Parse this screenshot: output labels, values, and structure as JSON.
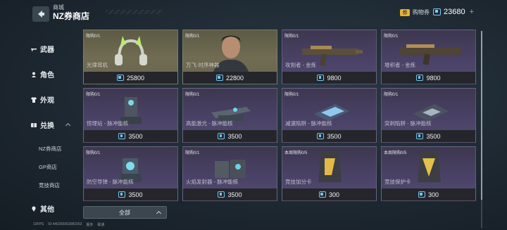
{
  "header": {
    "breadcrumb": "商城",
    "title": "NZ券商店",
    "voucher_icon_text": "券",
    "voucher_label": "购物券",
    "nz_balance": "23680",
    "plus": "+"
  },
  "sidebar": {
    "items": [
      {
        "label": "武器",
        "icon": "rifle-icon"
      },
      {
        "label": "角色",
        "icon": "person-icon"
      },
      {
        "label": "外观",
        "icon": "shirt-icon"
      },
      {
        "label": "兑换",
        "icon": "exchange-icon"
      },
      {
        "label": "其他",
        "icon": "pin-icon"
      }
    ],
    "sub_items": [
      "NZ券商店",
      "GP商店",
      "竞技商店"
    ]
  },
  "cards": [
    {
      "limit": "限购0/1",
      "name": "光律耳机",
      "price": "25800",
      "theme": "gold"
    },
    {
      "limit": "限购0/1",
      "name": "万飞·时序神器",
      "price": "22800",
      "theme": "gold"
    },
    {
      "limit": "限购0/1",
      "name": "攻割者 - 金炼",
      "price": "9800",
      "theme": "purple"
    },
    {
      "limit": "限购0/1",
      "name": "堆积者 - 金炼",
      "price": "9800",
      "theme": "purple"
    },
    {
      "limit": "限购0/1",
      "name": "惊理站 - 脉冲能核",
      "price": "3500",
      "theme": "purple"
    },
    {
      "limit": "限购0/1",
      "name": "高能激光 - 脉冲能核",
      "price": "3500",
      "theme": "purple"
    },
    {
      "limit": "限购0/1",
      "name": "减速陷阱 - 脉冲能核",
      "price": "3500",
      "theme": "purple"
    },
    {
      "limit": "限购0/1",
      "name": "突刺陷阱 - 脉冲能核",
      "price": "3500",
      "theme": "purple"
    },
    {
      "limit": "限购0/1",
      "name": "防空导弹 - 脉冲能核",
      "price": "3500",
      "theme": "purple"
    },
    {
      "limit": "限购0/1",
      "name": "火焰发射器 - 脉冲能核",
      "price": "3500",
      "theme": "purple"
    },
    {
      "limit": "本周限购0/5",
      "name": "竞技加分卡",
      "price": "300",
      "theme": "purple"
    },
    {
      "limit": "本周限购0/5",
      "name": "竞技保护卡",
      "price": "300",
      "theme": "purple"
    }
  ],
  "filter": {
    "label": "全部"
  },
  "footer": {
    "fps": "10FPS",
    "id": "ID:440265063981553",
    "region": "服务",
    "server": "联通"
  }
}
